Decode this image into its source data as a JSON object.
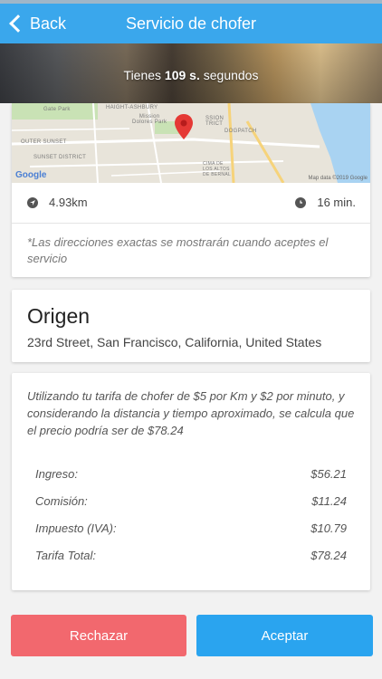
{
  "nav": {
    "back_label": "Back",
    "title": "Servicio de chofer"
  },
  "banner": {
    "prefix": "Tienes ",
    "seconds": "109 s.",
    "suffix": " segundos"
  },
  "map": {
    "labels": {
      "gate_park": "Gate Park",
      "haight": "HAIGHT-ASHBURY",
      "mission_dolores": "Mission\nDolores Park",
      "outer_sunset": "OUTER SUNSET",
      "sunset_district": "SUNSET DISTRICT",
      "mission_district": "SSION\nTRICT",
      "dogpatch": "DOGPATCH",
      "cima": "CIMA DE\nLOS ALTOS\nDE BERNAL"
    },
    "attribution": "Google",
    "map_data": "Map data ©2019 Google"
  },
  "trip": {
    "distance": "4.93km",
    "time": "16 min.",
    "disclaimer": "*Las direcciones exactas se mostrarán cuando aceptes el servicio"
  },
  "origin": {
    "title": "Origen",
    "address": "23rd Street, San Francisco, California, United States"
  },
  "pricing": {
    "description": "Utilizando tu tarifa de chofer de $5 por Km y $2 por minuto, y considerando la distancia y tiempo aproximado, se calcula que el precio podría ser de $78.24",
    "rows": [
      {
        "label": "Ingreso:",
        "value": "$56.21"
      },
      {
        "label": "Comisión:",
        "value": "$11.24"
      },
      {
        "label": "Impuesto (IVA):",
        "value": "$10.79"
      },
      {
        "label": "Tarifa Total:",
        "value": "$78.24"
      }
    ]
  },
  "actions": {
    "reject_label": "Rechazar",
    "accept_label": "Aceptar"
  },
  "colors": {
    "nav": "#3aa7ec",
    "reject": "#f2686e",
    "accept": "#2aa4ef",
    "pin": "#e53935"
  }
}
